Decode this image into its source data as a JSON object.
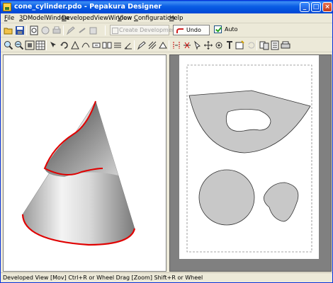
{
  "window": {
    "title": "cone_cylinder.pdo - Pepakura Designer",
    "controls": {
      "minimize": "_",
      "maximize": "□",
      "close": "×"
    }
  },
  "menu": [
    {
      "underline": "F",
      "rest": "ile"
    },
    {
      "underline": "3",
      "rest": "DModelWindow"
    },
    {
      "underline": "D",
      "rest": "evelopedViewWindow"
    },
    {
      "underline": "V",
      "rest": "iew"
    },
    {
      "underline": "C",
      "rest": "onfiguration"
    },
    {
      "underline": "H",
      "rest": "elp"
    }
  ],
  "toolbar1": {
    "create_development": "Create Development",
    "undo": "Undo",
    "auto_label": "Auto",
    "auto_checked": true
  },
  "status": {
    "text": "Developed View [Mov] Ctrl+R or Wheel Drag [Zoom] Shift+R or Wheel"
  },
  "colors": {
    "titlebar": "#0a5de4",
    "cut_edge": "#e00000",
    "part_fill": "#c8c8c8",
    "paper_bg": "#808080"
  }
}
